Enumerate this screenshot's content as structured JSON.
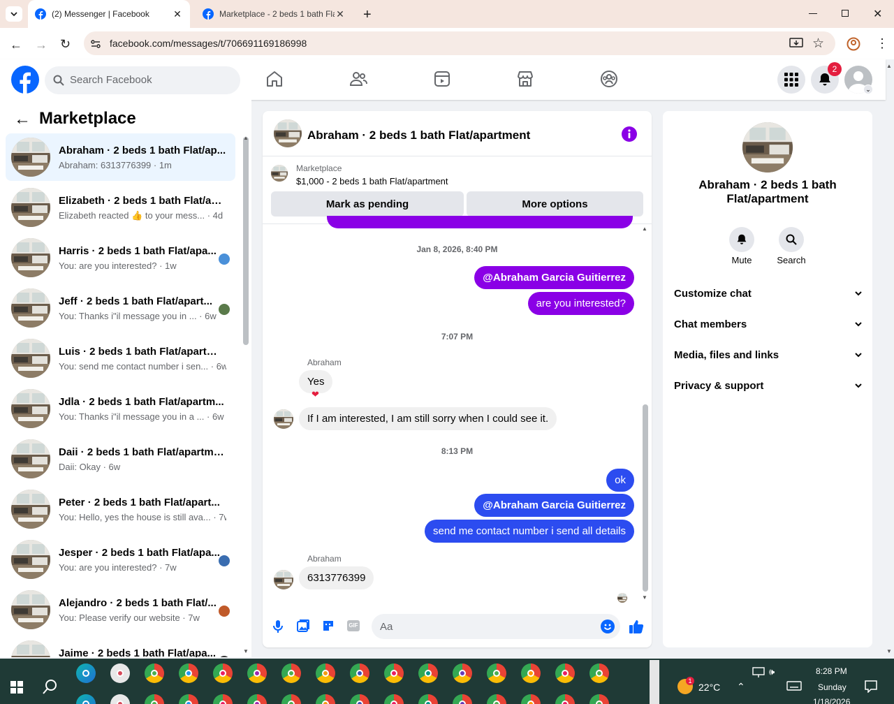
{
  "browser": {
    "tabs": [
      {
        "label": "(2) Messenger | Facebook"
      },
      {
        "label": "Marketplace - 2 beds 1 bath Fla"
      }
    ],
    "url": "facebook.com/messages/t/706691169186998"
  },
  "header": {
    "search_placeholder": "Search Facebook",
    "notification_count": "2"
  },
  "left": {
    "title": "Marketplace",
    "conversations": [
      {
        "name": "Abraham · 2 beds 1 bath Flat/ap...",
        "preview": "Abraham: 6313776399 · 1m",
        "selected": true
      },
      {
        "name": "Elizabeth · 2 beds 1 bath Flat/ap...",
        "preview": "Elizabeth reacted 👍 to your mess... · 4d"
      },
      {
        "name": "Harris · 2 beds 1 bath Flat/apa...",
        "preview": "You: are you interested? · 1w"
      },
      {
        "name": "Jeff · 2 beds 1 bath Flat/apart...",
        "preview": "You: Thanks i\"il message you in ... · 6w"
      },
      {
        "name": "Luis · 2 beds 1 bath Flat/apartme...",
        "preview": "You: send me contact number i sen... · 6w"
      },
      {
        "name": "Jdla · 2 beds 1 bath Flat/apartm...",
        "preview": "You: Thanks i\"il message you in a ... · 6w"
      },
      {
        "name": "Daii · 2 beds 1 bath Flat/apartme...",
        "preview": "Daii: Okay · 6w"
      },
      {
        "name": "Peter · 2 beds 1 bath Flat/apart...",
        "preview": "You: Hello, yes the house is still ava... · 7w"
      },
      {
        "name": "Jesper · 2 beds 1 bath Flat/apa...",
        "preview": "You: are you interested? · 7w"
      },
      {
        "name": "Alejandro · 2 beds 1 bath Flat/...",
        "preview": "You: Please verify our website · 7w"
      },
      {
        "name": "Jaime · 2 beds 1 bath Flat/apa...",
        "preview": ""
      }
    ]
  },
  "chat": {
    "title": "Abraham · 2 beds 1 bath Flat/apartment",
    "listing_source": "Marketplace",
    "listing_title": "$1,000 - 2 beds 1 bath Flat/apartment",
    "mark_pending": "Mark as pending",
    "more_options": "More options",
    "ts1": "Jan 8, 2026, 8:40 PM",
    "msg_mention1": "@Abraham Garcia Guitierrez",
    "msg_interested": "are you interested?",
    "ts2": "7:07 PM",
    "sender1": "Abraham",
    "msg_yes": "Yes",
    "msg_if": "If I am interested, I am still sorry when I could see it.",
    "ts3": "8:13 PM",
    "msg_ok": "ok",
    "msg_mention2": "@Abraham Garcia Guitierrez",
    "msg_send": "send me contact number i send all details",
    "sender2": "Abraham",
    "msg_number": "6313776399",
    "composer_placeholder": "Aa"
  },
  "right": {
    "title": "Abraham · 2 beds 1 bath Flat/apartment",
    "mute": "Mute",
    "search": "Search",
    "sections": [
      "Customize chat",
      "Chat members",
      "Media, files and links",
      "Privacy & support"
    ]
  },
  "taskbar": {
    "temperature": "22°C",
    "weather_badge": "1",
    "time": "8:28 PM",
    "day": "Sunday",
    "date": "1/18/2026"
  },
  "colors": {
    "fb_blue": "#0866ff",
    "messenger_purple": "#8a00e6",
    "messenger_blue": "#2c4cf0"
  }
}
